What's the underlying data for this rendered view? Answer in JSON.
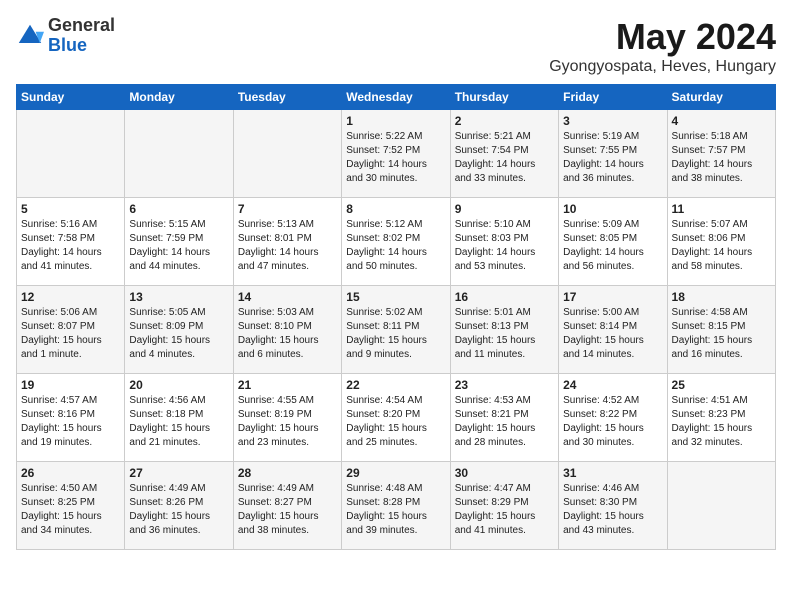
{
  "header": {
    "logo": {
      "general": "General",
      "blue": "Blue"
    },
    "title": "May 2024",
    "subtitle": "Gyongyospata, Heves, Hungary"
  },
  "days_of_week": [
    "Sunday",
    "Monday",
    "Tuesday",
    "Wednesday",
    "Thursday",
    "Friday",
    "Saturday"
  ],
  "weeks": [
    [
      {
        "day": "",
        "info": ""
      },
      {
        "day": "",
        "info": ""
      },
      {
        "day": "",
        "info": ""
      },
      {
        "day": "1",
        "info": "Sunrise: 5:22 AM\nSunset: 7:52 PM\nDaylight: 14 hours\nand 30 minutes."
      },
      {
        "day": "2",
        "info": "Sunrise: 5:21 AM\nSunset: 7:54 PM\nDaylight: 14 hours\nand 33 minutes."
      },
      {
        "day": "3",
        "info": "Sunrise: 5:19 AM\nSunset: 7:55 PM\nDaylight: 14 hours\nand 36 minutes."
      },
      {
        "day": "4",
        "info": "Sunrise: 5:18 AM\nSunset: 7:57 PM\nDaylight: 14 hours\nand 38 minutes."
      }
    ],
    [
      {
        "day": "5",
        "info": "Sunrise: 5:16 AM\nSunset: 7:58 PM\nDaylight: 14 hours\nand 41 minutes."
      },
      {
        "day": "6",
        "info": "Sunrise: 5:15 AM\nSunset: 7:59 PM\nDaylight: 14 hours\nand 44 minutes."
      },
      {
        "day": "7",
        "info": "Sunrise: 5:13 AM\nSunset: 8:01 PM\nDaylight: 14 hours\nand 47 minutes."
      },
      {
        "day": "8",
        "info": "Sunrise: 5:12 AM\nSunset: 8:02 PM\nDaylight: 14 hours\nand 50 minutes."
      },
      {
        "day": "9",
        "info": "Sunrise: 5:10 AM\nSunset: 8:03 PM\nDaylight: 14 hours\nand 53 minutes."
      },
      {
        "day": "10",
        "info": "Sunrise: 5:09 AM\nSunset: 8:05 PM\nDaylight: 14 hours\nand 56 minutes."
      },
      {
        "day": "11",
        "info": "Sunrise: 5:07 AM\nSunset: 8:06 PM\nDaylight: 14 hours\nand 58 minutes."
      }
    ],
    [
      {
        "day": "12",
        "info": "Sunrise: 5:06 AM\nSunset: 8:07 PM\nDaylight: 15 hours\nand 1 minute."
      },
      {
        "day": "13",
        "info": "Sunrise: 5:05 AM\nSunset: 8:09 PM\nDaylight: 15 hours\nand 4 minutes."
      },
      {
        "day": "14",
        "info": "Sunrise: 5:03 AM\nSunset: 8:10 PM\nDaylight: 15 hours\nand 6 minutes."
      },
      {
        "day": "15",
        "info": "Sunrise: 5:02 AM\nSunset: 8:11 PM\nDaylight: 15 hours\nand 9 minutes."
      },
      {
        "day": "16",
        "info": "Sunrise: 5:01 AM\nSunset: 8:13 PM\nDaylight: 15 hours\nand 11 minutes."
      },
      {
        "day": "17",
        "info": "Sunrise: 5:00 AM\nSunset: 8:14 PM\nDaylight: 15 hours\nand 14 minutes."
      },
      {
        "day": "18",
        "info": "Sunrise: 4:58 AM\nSunset: 8:15 PM\nDaylight: 15 hours\nand 16 minutes."
      }
    ],
    [
      {
        "day": "19",
        "info": "Sunrise: 4:57 AM\nSunset: 8:16 PM\nDaylight: 15 hours\nand 19 minutes."
      },
      {
        "day": "20",
        "info": "Sunrise: 4:56 AM\nSunset: 8:18 PM\nDaylight: 15 hours\nand 21 minutes."
      },
      {
        "day": "21",
        "info": "Sunrise: 4:55 AM\nSunset: 8:19 PM\nDaylight: 15 hours\nand 23 minutes."
      },
      {
        "day": "22",
        "info": "Sunrise: 4:54 AM\nSunset: 8:20 PM\nDaylight: 15 hours\nand 25 minutes."
      },
      {
        "day": "23",
        "info": "Sunrise: 4:53 AM\nSunset: 8:21 PM\nDaylight: 15 hours\nand 28 minutes."
      },
      {
        "day": "24",
        "info": "Sunrise: 4:52 AM\nSunset: 8:22 PM\nDaylight: 15 hours\nand 30 minutes."
      },
      {
        "day": "25",
        "info": "Sunrise: 4:51 AM\nSunset: 8:23 PM\nDaylight: 15 hours\nand 32 minutes."
      }
    ],
    [
      {
        "day": "26",
        "info": "Sunrise: 4:50 AM\nSunset: 8:25 PM\nDaylight: 15 hours\nand 34 minutes."
      },
      {
        "day": "27",
        "info": "Sunrise: 4:49 AM\nSunset: 8:26 PM\nDaylight: 15 hours\nand 36 minutes."
      },
      {
        "day": "28",
        "info": "Sunrise: 4:49 AM\nSunset: 8:27 PM\nDaylight: 15 hours\nand 38 minutes."
      },
      {
        "day": "29",
        "info": "Sunrise: 4:48 AM\nSunset: 8:28 PM\nDaylight: 15 hours\nand 39 minutes."
      },
      {
        "day": "30",
        "info": "Sunrise: 4:47 AM\nSunset: 8:29 PM\nDaylight: 15 hours\nand 41 minutes."
      },
      {
        "day": "31",
        "info": "Sunrise: 4:46 AM\nSunset: 8:30 PM\nDaylight: 15 hours\nand 43 minutes."
      },
      {
        "day": "",
        "info": ""
      }
    ]
  ]
}
